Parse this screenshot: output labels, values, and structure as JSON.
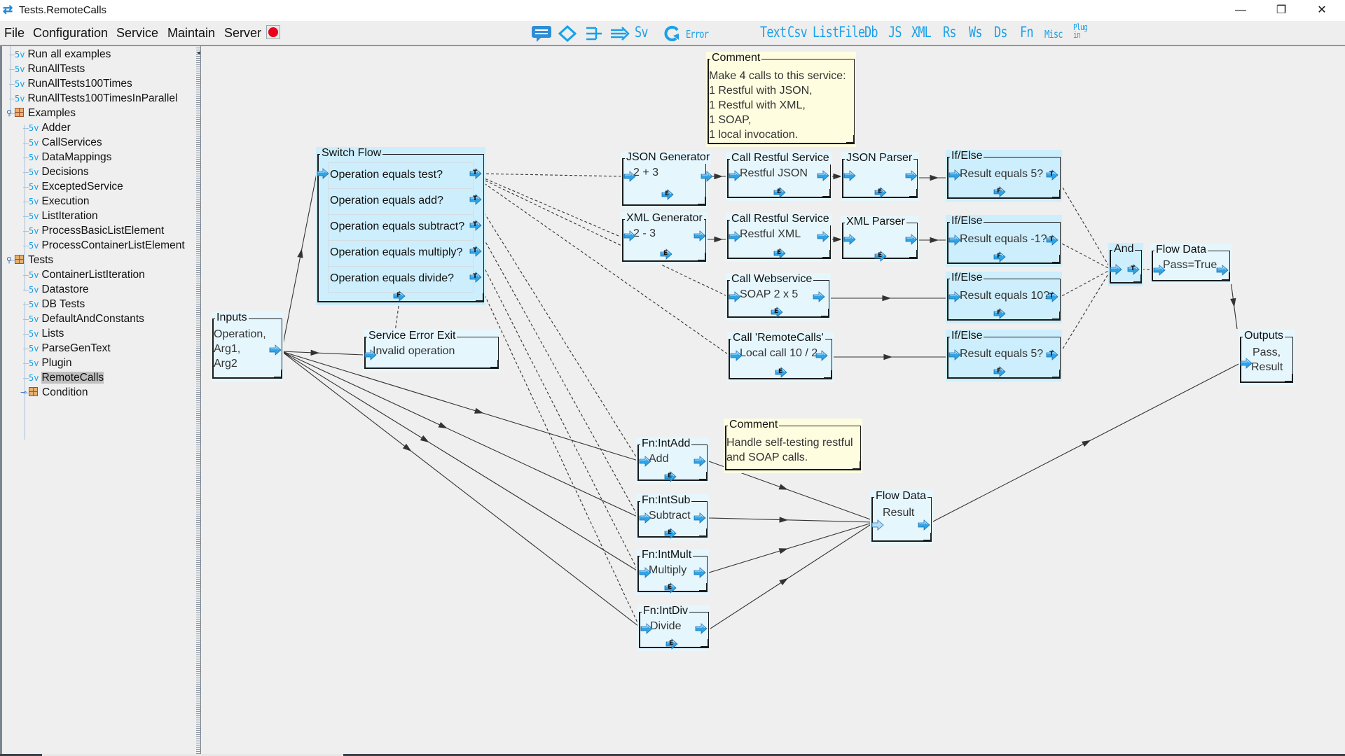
{
  "window": {
    "title": "Tests.RemoteCalls",
    "controls": {
      "minimize": "—",
      "maximize": "❐",
      "close": "✕"
    }
  },
  "menu": {
    "items": [
      {
        "label": "File",
        "mnemonic": "F"
      },
      {
        "label": "Configuration",
        "mnemonic": "C"
      },
      {
        "label": "Service",
        "mnemonic": "S"
      },
      {
        "label": "Maintain",
        "mnemonic": "M"
      },
      {
        "label": "Server",
        "mnemonic": "v"
      }
    ],
    "server_status_color": "#e8001c"
  },
  "toolbar": {
    "nodes": [
      "comment-icon",
      "decision-icon",
      "switch-icon",
      "flow-icon",
      "Sv",
      "loop-icon",
      "Error"
    ],
    "palette": [
      "Text",
      "Csv",
      "List",
      "File",
      "Db",
      "JS",
      "XML",
      "Rs",
      "Ws",
      "Ds",
      "Fn",
      "Misc",
      "Plug in"
    ]
  },
  "sidebar": {
    "items": [
      {
        "label": "Run all examples",
        "type": "service",
        "level": 0
      },
      {
        "label": "RunAllTests",
        "type": "service",
        "level": 0
      },
      {
        "label": "RunAllTests100Times",
        "type": "service",
        "level": 0
      },
      {
        "label": "RunAllTests100TimesInParallel",
        "type": "service",
        "level": 0
      },
      {
        "label": "Examples",
        "type": "folder",
        "level": 0,
        "expanded": true
      },
      {
        "label": "Adder",
        "type": "service",
        "level": 1
      },
      {
        "label": "CallServices",
        "type": "service",
        "level": 1
      },
      {
        "label": "DataMappings",
        "type": "service",
        "level": 1
      },
      {
        "label": "Decisions",
        "type": "service",
        "level": 1
      },
      {
        "label": "ExceptedService",
        "type": "service",
        "level": 1
      },
      {
        "label": "Execution",
        "type": "service",
        "level": 1
      },
      {
        "label": "ListIteration",
        "type": "service",
        "level": 1
      },
      {
        "label": "ProcessBasicListElement",
        "type": "service",
        "level": 1
      },
      {
        "label": "ProcessContainerListElement",
        "type": "service",
        "level": 1
      },
      {
        "label": "Tests",
        "type": "folder",
        "level": 0,
        "expanded": true
      },
      {
        "label": "ContainerListIteration",
        "type": "service",
        "level": 1
      },
      {
        "label": "Datastore",
        "type": "service",
        "level": 1
      },
      {
        "label": "DB Tests",
        "type": "service",
        "level": 1
      },
      {
        "label": "DefaultAndConstants",
        "type": "service",
        "level": 1
      },
      {
        "label": "Lists",
        "type": "service",
        "level": 1
      },
      {
        "label": "ParseGenText",
        "type": "service",
        "level": 1
      },
      {
        "label": "Plugin",
        "type": "service",
        "level": 1
      },
      {
        "label": "RemoteCalls",
        "type": "service",
        "level": 1,
        "selected": true
      },
      {
        "label": "Condition",
        "type": "folder",
        "level": 1,
        "expanded": false
      }
    ],
    "service_badge": "5v"
  },
  "canvas": {
    "comment1": {
      "title": "Comment",
      "lines": [
        "Make 4 calls to this service:",
        "1 Restful with JSON,",
        "1 Restful with XML,",
        "1 SOAP,",
        "1 local invocation."
      ]
    },
    "comment2": {
      "title": "Comment",
      "lines": [
        "Handle self-testing restful",
        "and SOAP calls."
      ]
    },
    "inputs": {
      "title": "Inputs",
      "lines": [
        "Operation,",
        "Arg1,",
        "Arg2"
      ]
    },
    "switch": {
      "title": "Switch Flow",
      "conditions": [
        "Operation equals test?",
        "Operation equals add?",
        "Operation equals subtract?",
        "Operation equals multiply?",
        "Operation equals divide?"
      ]
    },
    "error_exit": {
      "title": "Service Error Exit",
      "body": "Invalid operation"
    },
    "json_gen": {
      "title": "JSON Generator",
      "body": "2 + 3"
    },
    "xml_gen": {
      "title": "XML Generator",
      "body": "2 - 3"
    },
    "rest_json": {
      "title": "Call Restful Service",
      "body": "Restful JSON"
    },
    "rest_xml": {
      "title": "Call Restful Service",
      "body": "Restful XML"
    },
    "json_parser": {
      "title": "JSON Parser",
      "body": ""
    },
    "xml_parser": {
      "title": "XML Parser",
      "body": ""
    },
    "webservice": {
      "title": "Call Webservice",
      "body": "SOAP 2 x 5"
    },
    "local_call": {
      "title": "Call 'RemoteCalls'",
      "body": "Local call 10 / 2"
    },
    "ifelse": [
      {
        "title": "If/Else",
        "body": "Result equals 5?"
      },
      {
        "title": "If/Else",
        "body": "Result equals -1?"
      },
      {
        "title": "If/Else",
        "body": "Result equals 10?"
      },
      {
        "title": "If/Else",
        "body": "Result equals 5?"
      }
    ],
    "and": {
      "title": "And"
    },
    "flow_pass": {
      "title": "Flow Data",
      "body": "Pass=True"
    },
    "outputs": {
      "title": "Outputs",
      "lines": [
        "Pass,",
        "Result"
      ]
    },
    "fn_add": {
      "title": "Fn:IntAdd",
      "body": "Add"
    },
    "fn_sub": {
      "title": "Fn:IntSub",
      "body": "Subtract"
    },
    "fn_mult": {
      "title": "Fn:IntMult",
      "body": "Multiply"
    },
    "fn_div": {
      "title": "Fn:IntDiv",
      "body": "Divide"
    },
    "flow_result": {
      "title": "Flow Data",
      "body": "Result"
    },
    "port_labels": {
      "true": "T",
      "false": "F",
      "error": "E"
    }
  }
}
